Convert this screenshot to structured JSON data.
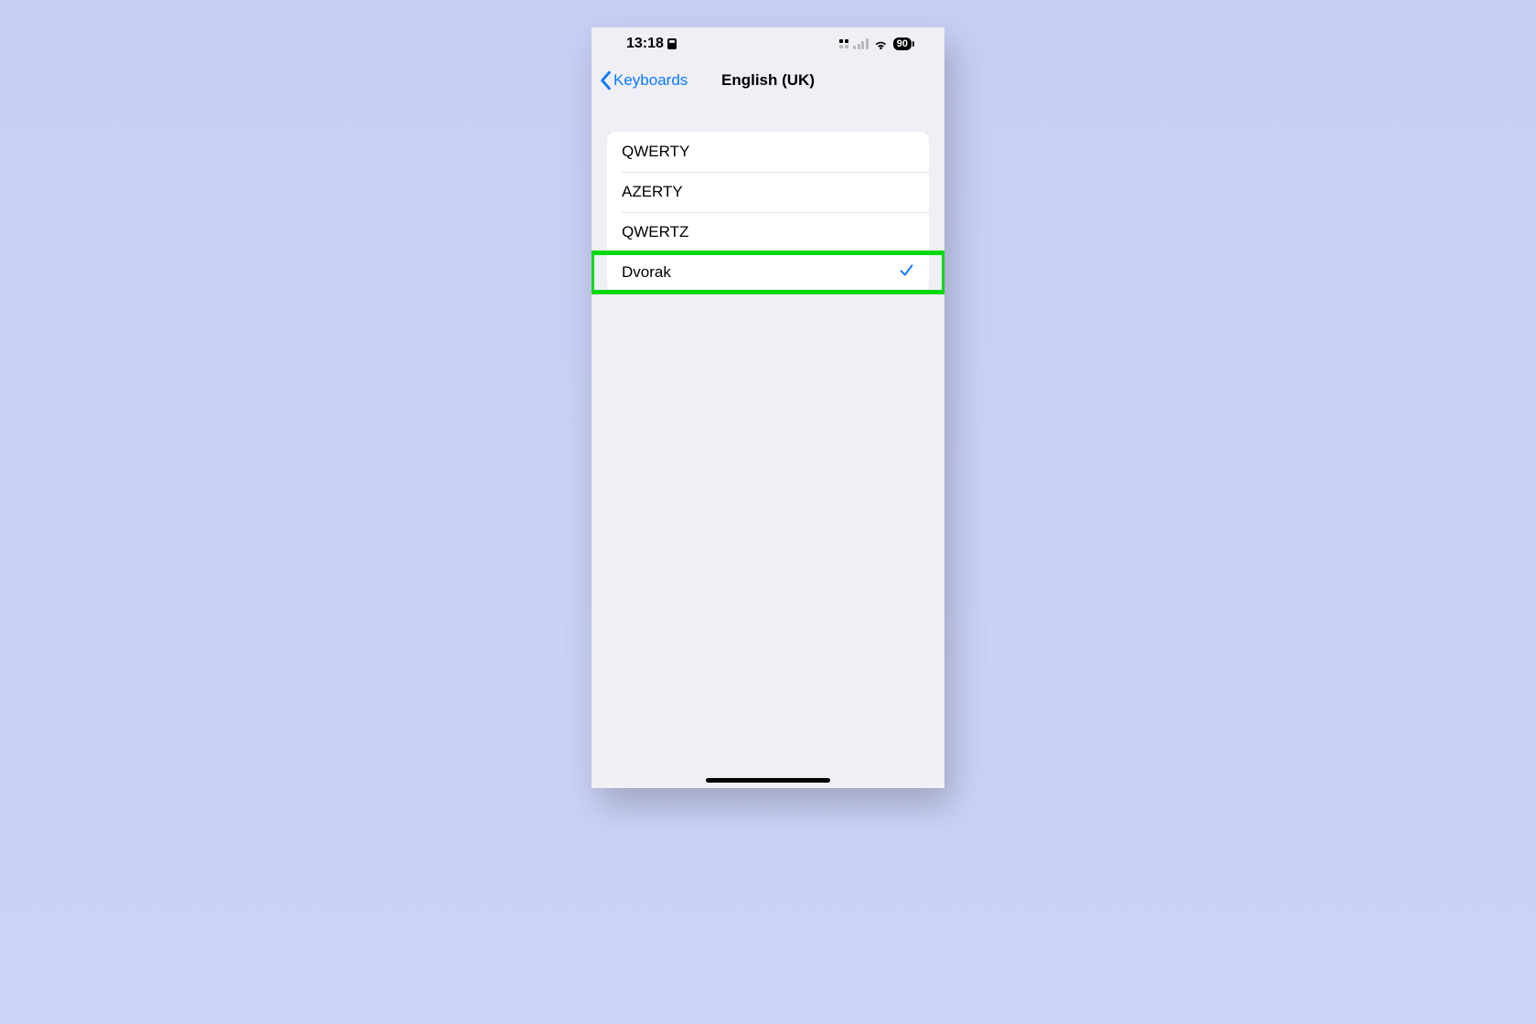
{
  "statusbar": {
    "time": "13:18",
    "battery_level": "90"
  },
  "nav": {
    "back_label": "Keyboards",
    "title": "English (UK)"
  },
  "layouts": {
    "items": [
      {
        "label": "QWERTY",
        "selected": false
      },
      {
        "label": "AZERTY",
        "selected": false
      },
      {
        "label": "QWERTZ",
        "selected": false
      },
      {
        "label": "Dvorak",
        "selected": true,
        "highlighted": true
      }
    ]
  },
  "annotation": {
    "highlight_color": "#00d80d"
  }
}
